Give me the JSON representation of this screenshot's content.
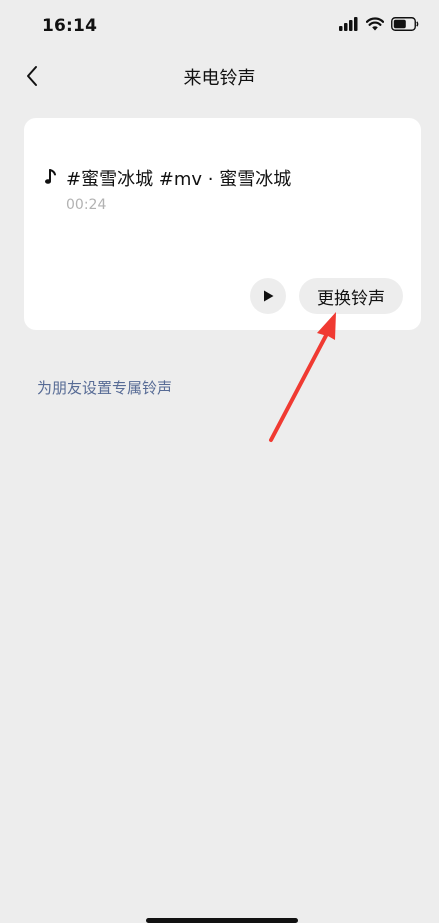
{
  "status_bar": {
    "time": "16:14",
    "icons": [
      "signal-icon",
      "wifi-icon",
      "battery-icon"
    ]
  },
  "nav": {
    "back_icon": "chevron-left-icon",
    "title": "来电铃声"
  },
  "ringtone": {
    "icon": "music-note-icon",
    "title": "#蜜雪冰城 #mv · 蜜雪冰城",
    "duration": "00:24",
    "play_icon": "play-icon",
    "change_label": "更换铃声"
  },
  "friend_ringtone_link": "为朋友设置专属铃声",
  "colors": {
    "background": "#ededed",
    "card": "#ffffff",
    "link": "#576b95",
    "annotation": "#f03a32"
  }
}
